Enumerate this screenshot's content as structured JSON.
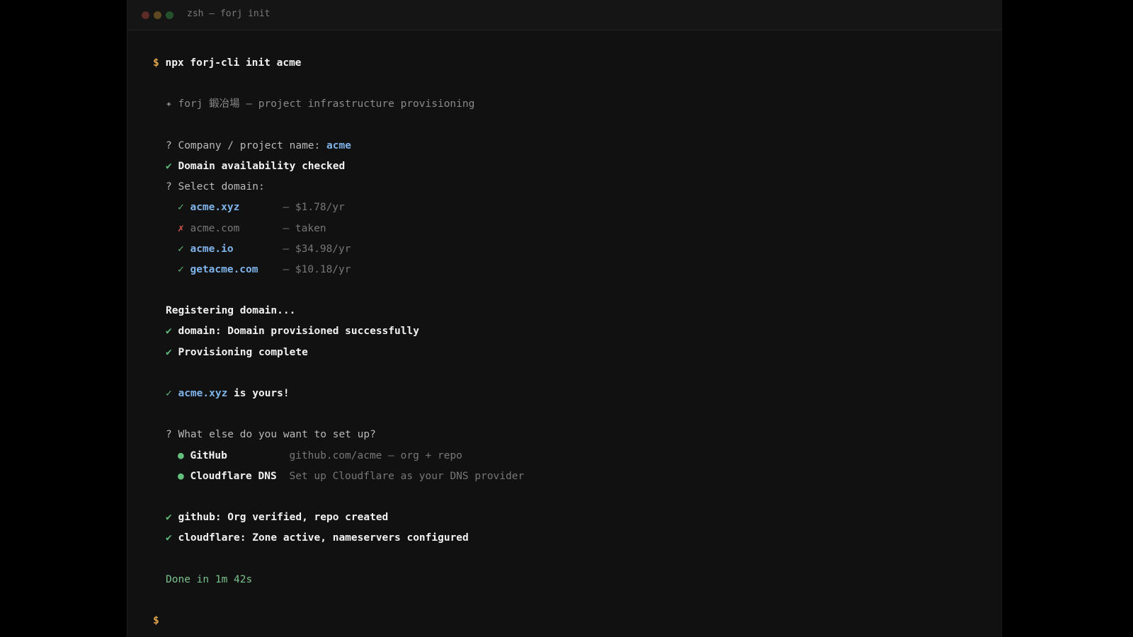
{
  "window": {
    "title": "zsh — forj init"
  },
  "terminal": {
    "prompt_symbol": "$",
    "command": "npx forj-cli init acme",
    "banner": {
      "icon": "✦",
      "text": "forj 鍛冶場 — project infrastructure provisioning"
    },
    "project_question": {
      "mark": "?",
      "label": "Company / project name:",
      "answer": "acme"
    },
    "domain_check": {
      "mark": "✔",
      "text": "Domain availability checked"
    },
    "select_domain": {
      "mark": "?",
      "label": "Select domain:"
    },
    "domains": [
      {
        "status": "✓",
        "name": "acme.xyz",
        "detail": "— $1.78/yr",
        "available": true
      },
      {
        "status": "✗",
        "name": "acme.com",
        "detail": "— taken",
        "available": false
      },
      {
        "status": "✓",
        "name": "acme.io",
        "detail": "— $34.98/yr",
        "available": true
      },
      {
        "status": "✓",
        "name": "getacme.com",
        "detail": "— $10.18/yr",
        "available": true
      }
    ],
    "registering": "Registering domain...",
    "registration_steps": [
      {
        "mark": "✔",
        "text": "domain: Domain provisioned successfully"
      },
      {
        "mark": "✔",
        "text": "Provisioning complete"
      }
    ],
    "owned": {
      "mark": "✓",
      "domain": "acme.xyz",
      "suffix": " is yours!"
    },
    "setup_question": {
      "mark": "?",
      "label": "What else do you want to set up?"
    },
    "services": [
      {
        "bullet": "●",
        "name": "GitHub",
        "description": "github.com/acme — org + repo"
      },
      {
        "bullet": "●",
        "name": "Cloudflare DNS",
        "description": "Set up Cloudflare as your DNS provider"
      }
    ],
    "service_results": [
      {
        "mark": "✔",
        "text": "github: Org verified, repo created"
      },
      {
        "mark": "✔",
        "text": "cloudflare: Zone active, nameservers configured"
      }
    ],
    "done": "Done in 1m 42s",
    "final_prompt": "$"
  }
}
